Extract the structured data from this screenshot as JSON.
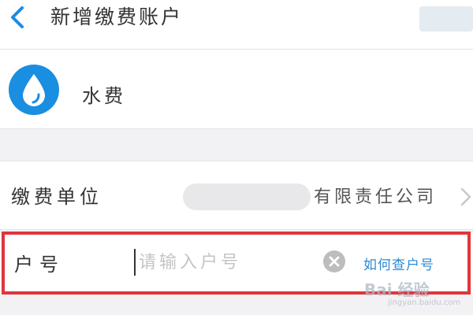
{
  "header": {
    "title": "新增缴费账户",
    "back_icon": "chevron-left-icon"
  },
  "biller": {
    "icon": "water-drop-icon",
    "name": "水费"
  },
  "form": {
    "unit_label": "缴费单位",
    "unit_value": "有限责任公司",
    "account_label": "户号",
    "account_value": "",
    "account_placeholder": "请输入户号",
    "help_link": "如何查户号"
  },
  "watermark": {
    "text": "Bai 经验",
    "sub": "jingyan.baidu.com"
  },
  "colors": {
    "accent": "#1a8ee0",
    "link": "#2b8ad8",
    "highlight": "#e0353b",
    "background": "#f2f2f4"
  }
}
